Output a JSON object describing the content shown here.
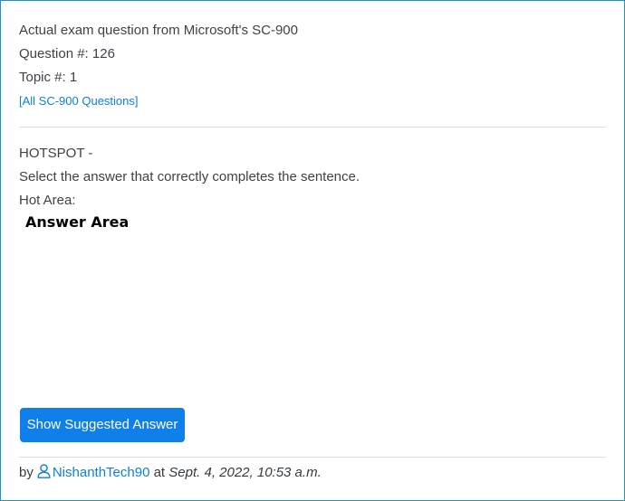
{
  "header": {
    "exam_line": "Actual exam question from Microsoft's SC-900",
    "question_number": "Question #: 126",
    "topic": "Topic #: 1",
    "all_questions_link": "[All SC-900 Questions]"
  },
  "question": {
    "type": "HOTSPOT -",
    "instruction": "Select the answer that correctly completes the sentence.",
    "hot_area_label": "Hot Area:",
    "answer_area_title": "Answer Area"
  },
  "actions": {
    "show_answer_label": "Show Suggested Answer"
  },
  "footer": {
    "by_label": "by",
    "user_icon": "user-outline-icon",
    "username": "NishanthTech90",
    "at_label": "at",
    "date": "Sept. 4, 2022, 10:53 a.m."
  },
  "colors": {
    "border": "#1a8fd6",
    "link": "#0f7fd0",
    "button": "#0f7fe9",
    "text": "#3d4247"
  }
}
